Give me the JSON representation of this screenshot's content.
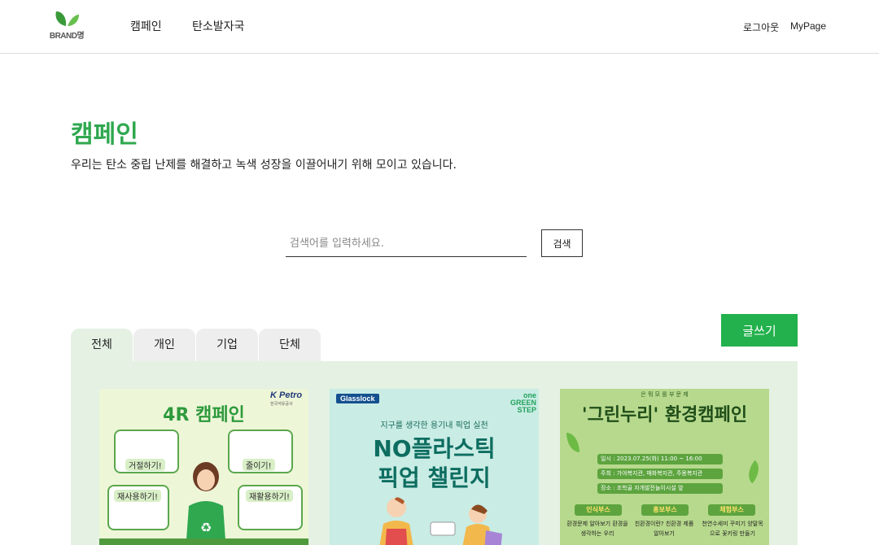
{
  "header": {
    "logo_text": "BRAND명",
    "nav": {
      "campaign": "캠페인",
      "carbon": "탄소발자국"
    },
    "logout": "로그아웃",
    "mypage": "MyPage"
  },
  "main": {
    "title": "캠페인",
    "description": "우리는 탄소 중립 난제를 해결하고 녹색 성장을 이끌어내기 위해 모이고 있습니다."
  },
  "search": {
    "placeholder": "검색어를 입력하세요.",
    "value": "",
    "button_label": "검색"
  },
  "tabs": [
    {
      "label": "전체",
      "active": true
    },
    {
      "label": "개인",
      "active": false
    },
    {
      "label": "기업",
      "active": false
    },
    {
      "label": "단체",
      "active": false
    }
  ],
  "write_button": "글쓰기",
  "colors": {
    "brand_green": "#22b14c",
    "title_green": "#2fa84f",
    "panel_bg": "#e4f1e3"
  },
  "cards": [
    {
      "title": "4R 캠페인",
      "logo": "K Petro",
      "logo_sub": "한국석유공사",
      "labels": [
        "거절하기!",
        "줄이기!",
        "재사용하기!",
        "재활용하기!"
      ]
    },
    {
      "badge": "Glasslock",
      "step": "one GREEN STEP",
      "subtitle": "지구를 생각한 용기내 픽업 실천",
      "title_line1": "NO플라스틱",
      "title_line2": "픽업 챌린지"
    },
    {
      "top_text": "은 뭐 모 를 부 문 제",
      "title": "'그린누리' 환경캠페인",
      "info": [
        "일시 : 2023.07.25(화) 11:00 ~ 16:00",
        "주최 : 가야복지관, 매화복지관, 주몽복지관",
        "장소 : 조학골 자개발전놀이시설 앞"
      ],
      "booths": [
        "인식부스",
        "홍보부스",
        "체험부스"
      ],
      "booth_desc": [
        "환경문제 알아보기 환경을 생각하는 우리",
        "친환경이란? 친환경 제품 알아보기",
        "천연수세미 꾸미기 양말목으로 꽃키링 만들기"
      ]
    }
  ]
}
